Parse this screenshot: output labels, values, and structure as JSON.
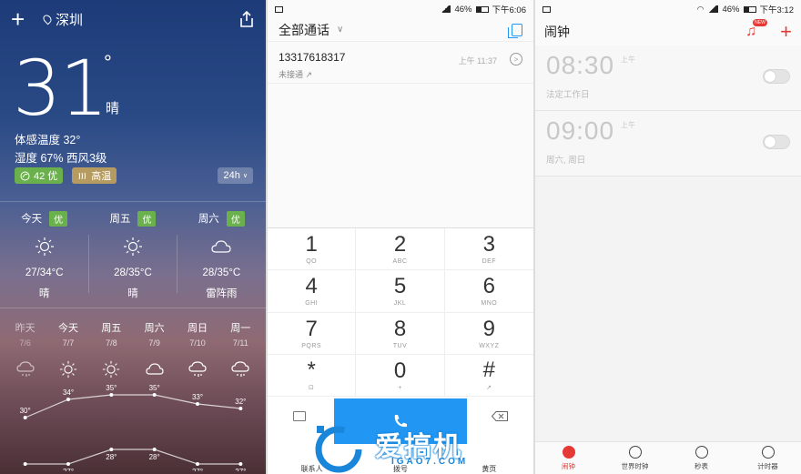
{
  "weather": {
    "city": "深圳",
    "temperature": "31",
    "degree": "°",
    "condition": "晴",
    "feels_like": "体感温度 32°",
    "humidity_wind": "湿度 67% 西风3级",
    "aqi_badge": "42 优",
    "heat_badge": "高温",
    "range_button": "24h",
    "days": [
      {
        "name": "今天",
        "quality": "优",
        "icon": "sun-icon",
        "range": "27/34°C",
        "condition": "晴"
      },
      {
        "name": "周五",
        "quality": "优",
        "icon": "sun-icon",
        "range": "28/35°C",
        "condition": "晴"
      },
      {
        "name": "周六",
        "quality": "优",
        "icon": "cloud-icon",
        "range": "28/35°C",
        "condition": "雷阵雨"
      }
    ],
    "forecast": [
      {
        "day": "昨天",
        "date": "7/6",
        "icon": "rain-cloud-icon",
        "high": 30,
        "low": 27
      },
      {
        "day": "今天",
        "date": "7/7",
        "icon": "sun-icon",
        "high": 34,
        "low": 27
      },
      {
        "day": "周五",
        "date": "7/8",
        "icon": "sun-icon",
        "high": 35,
        "low": 28
      },
      {
        "day": "周六",
        "date": "7/9",
        "icon": "cloud-icon",
        "high": 35,
        "low": 28
      },
      {
        "day": "周日",
        "date": "7/10",
        "icon": "rain-cloud-icon",
        "high": 33,
        "low": 27
      },
      {
        "day": "周一",
        "date": "7/11",
        "icon": "rain-cloud-icon",
        "high": 32,
        "low": 27
      }
    ],
    "high_labels": [
      "30°",
      "34°",
      "35°",
      "35°",
      "33°",
      "32°"
    ],
    "low_labels": [
      "",
      "27°",
      "28°",
      "28°",
      "27°",
      "27°"
    ]
  },
  "dialer": {
    "status": {
      "battery": "46%",
      "time": "下午6:06"
    },
    "title": "全部通话",
    "call": {
      "number": "13317618317",
      "status": "未接通",
      "time": "上午 11:37"
    },
    "keys": [
      {
        "num": "1",
        "letters": "QO"
      },
      {
        "num": "2",
        "letters": "ABC"
      },
      {
        "num": "3",
        "letters": "DEF"
      },
      {
        "num": "4",
        "letters": "GHI"
      },
      {
        "num": "5",
        "letters": "JKL"
      },
      {
        "num": "6",
        "letters": "MNO"
      },
      {
        "num": "7",
        "letters": "PQRS"
      },
      {
        "num": "8",
        "letters": "TUV"
      },
      {
        "num": "9",
        "letters": "WXYZ"
      },
      {
        "num": "*",
        "letters": "⊡"
      },
      {
        "num": "0",
        "letters": "+"
      },
      {
        "num": "#",
        "letters": "↗"
      }
    ],
    "tabs": [
      "联系人",
      "拨号",
      "黄页"
    ],
    "watermark": {
      "brand": "爱搞机",
      "url": "IGAO7.COM"
    }
  },
  "alarm": {
    "status": {
      "battery": "46%",
      "time": "下午3:12"
    },
    "title": "闹钟",
    "new_badge": "NEW",
    "alarms": [
      {
        "time": "08:30",
        "ampm": "上午",
        "repeat": "法定工作日",
        "enabled": false
      },
      {
        "time": "09:00",
        "ampm": "上午",
        "repeat": "周六, 周日",
        "enabled": false
      }
    ],
    "tabs": [
      "闹钟",
      "世界时钟",
      "秒表",
      "计时器"
    ]
  },
  "colors": {
    "accent_red": "#e53935",
    "accent_blue": "#2196f3",
    "badge_green": "#6ab04c"
  }
}
